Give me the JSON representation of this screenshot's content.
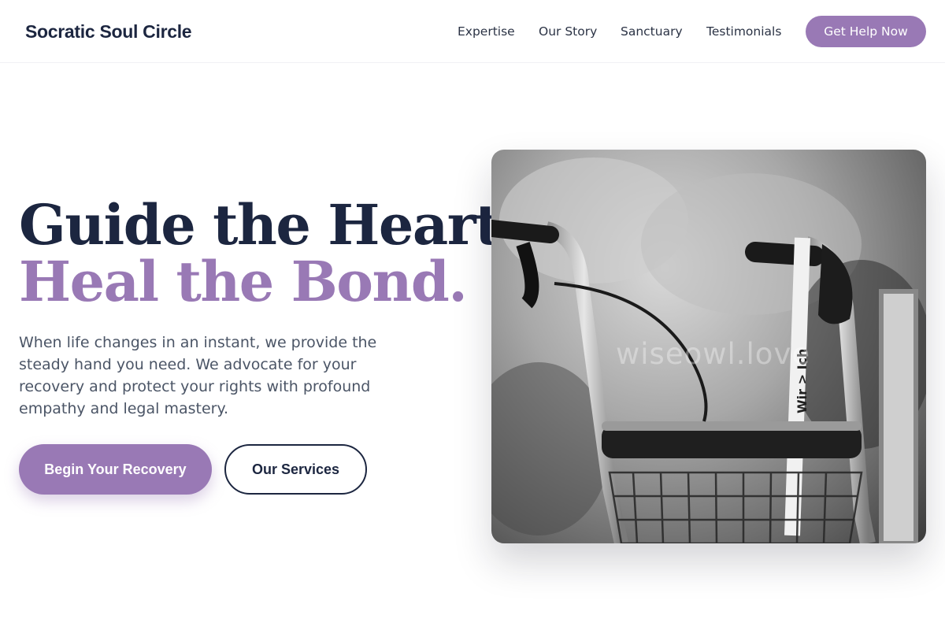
{
  "header": {
    "brand": "Socratic Soul Circle",
    "nav": [
      "Expertise",
      "Our Story",
      "Sanctuary",
      "Testimonials"
    ],
    "cta": "Get Help Now"
  },
  "hero": {
    "headline_line1": "Guide the Heart,",
    "headline_line2": "Heal the Bond.",
    "lead": "When life changes in an instant, we provide the steady hand you need. We advocate for your recovery and protect your rights with profound empathy and legal mastery.",
    "primary_button": "Begin Your Recovery",
    "secondary_button": "Our Services",
    "image": {
      "subject": "black-and-white photo of a rollator walker with handles, brake levers, a seat and wire basket",
      "watermark": "wiseowl.love",
      "strap_text": "Wir > Ich"
    }
  },
  "colors": {
    "accent": "#9979b5",
    "navy": "#1c2640",
    "body_text": "#4b5566"
  }
}
